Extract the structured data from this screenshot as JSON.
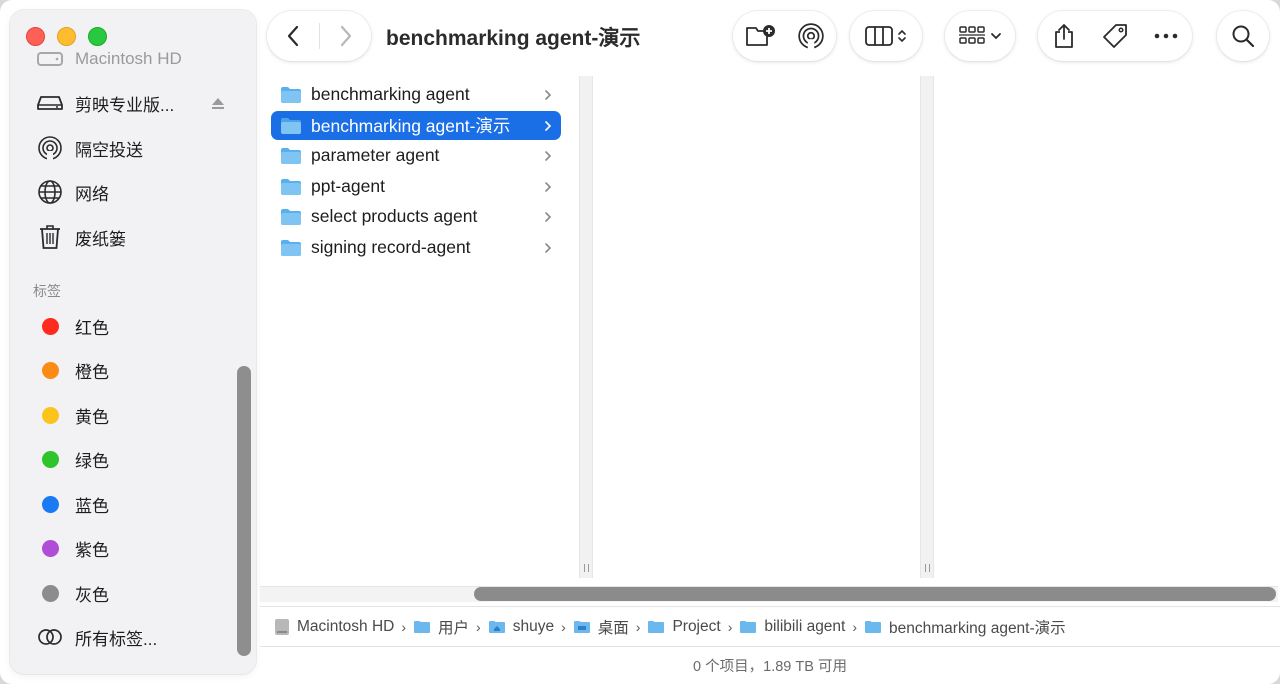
{
  "window": {
    "title": "benchmarking agent-演示"
  },
  "sidebar": {
    "faded_item": "Macintosh HD",
    "locations": [
      {
        "label": "剪映专业版...",
        "icon": "drive-icon"
      },
      {
        "label": "隔空投送",
        "icon": "airdrop-icon"
      },
      {
        "label": "网络",
        "icon": "network-icon"
      },
      {
        "label": "废纸篓",
        "icon": "trash-icon"
      }
    ],
    "tags_title": "标签",
    "tags": [
      {
        "label": "红色",
        "color": "#fe2b1e"
      },
      {
        "label": "橙色",
        "color": "#fe8a16"
      },
      {
        "label": "黄色",
        "color": "#fcc41a"
      },
      {
        "label": "绿色",
        "color": "#2ec52a"
      },
      {
        "label": "蓝色",
        "color": "#1a7af3"
      },
      {
        "label": "紫色",
        "color": "#b04dd6"
      },
      {
        "label": "灰色",
        "color": "#8c8c8e"
      }
    ],
    "all_tags": "所有标签..."
  },
  "column": {
    "items": [
      {
        "label": "benchmarking agent",
        "selected": false
      },
      {
        "label": "benchmarking agent-演示",
        "selected": true
      },
      {
        "label": "parameter agent",
        "selected": false
      },
      {
        "label": "ppt-agent",
        "selected": false
      },
      {
        "label": "select products agent",
        "selected": false
      },
      {
        "label": "signing record-agent",
        "selected": false
      }
    ]
  },
  "pathbar": {
    "crumbs": [
      "Macintosh HD",
      "用户",
      "shuye",
      "桌面",
      "Project",
      "bilibili agent",
      "benchmarking agent-演示"
    ]
  },
  "status": {
    "text": "0 个项目，1.89 TB 可用"
  },
  "colors": {
    "accent": "#1a6ee6",
    "folder": "#4aa8e8"
  }
}
